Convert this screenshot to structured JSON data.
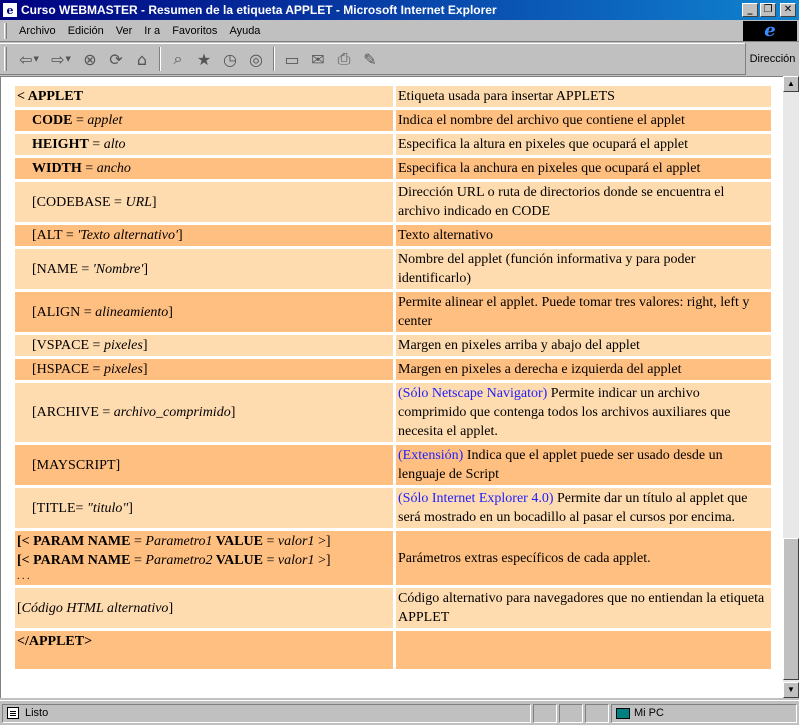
{
  "window": {
    "title": "Curso WEBMASTER - Resumen de la etiqueta APPLET - Microsoft Internet Explorer",
    "icon": "ie-document-icon"
  },
  "menu": {
    "items": [
      "Archivo",
      "Edición",
      "Ver",
      "Ir a",
      "Favoritos",
      "Ayuda"
    ]
  },
  "toolbar": {
    "icons": [
      "back-icon",
      "forward-icon",
      "stop-icon",
      "refresh-icon",
      "home-icon",
      "search-icon",
      "favorites-icon",
      "history-icon",
      "channels-icon",
      "fullscreen-icon",
      "mail-icon",
      "print-icon",
      "edit-icon"
    ],
    "address_label": "Dirección"
  },
  "colors": {
    "row_light": "#ffdcb0",
    "row_dark": "#ffbf80",
    "link_blue": "#2020ff"
  },
  "table": {
    "rows": [
      {
        "attr": "< APPLET",
        "desc": "Etiqueta usada para insertar APPLETS"
      },
      {
        "attr_name": "CODE",
        "attr_eq": "=",
        "attr_val": "applet",
        "desc": "Indica el nombre del archivo que contiene el applet"
      },
      {
        "attr_name": "HEIGHT",
        "attr_eq": "=",
        "attr_val": "alto",
        "desc": "Especifica la altura en pixeles que ocupará el applet"
      },
      {
        "attr_name": "WIDTH",
        "attr_eq": "=",
        "attr_val": "ancho",
        "desc": "Especifica la anchura en pixeles que ocupará el applet"
      },
      {
        "attr_pre": "[CODEBASE = ",
        "attr_val": "URL",
        "attr_post": "]",
        "desc": "Dirección URL o ruta de directorios donde se encuentra el archivo indicado en CODE"
      },
      {
        "attr_pre": "[ALT = ",
        "attr_val": "'Texto alternativo'",
        "attr_post": "]",
        "desc": "Texto alternativo"
      },
      {
        "attr_pre": "[NAME = ",
        "attr_val": "'Nombre'",
        "attr_post": "]",
        "desc": "Nombre del applet (función informativa y para poder identificarlo)"
      },
      {
        "attr_pre": "[ALIGN = ",
        "attr_val": "alineamiento",
        "attr_post": "]",
        "desc": "Permite alinear el applet. Puede tomar tres valores: right, left y center"
      },
      {
        "attr_pre": "[VSPACE = ",
        "attr_val": "pixeles",
        "attr_post": "]",
        "desc": "Margen en pixeles arriba y abajo del applet"
      },
      {
        "attr_pre": "[HSPACE = ",
        "attr_val": "pixeles",
        "attr_post": "]",
        "desc": "Margen en pixeles a derecha e izquierda del applet"
      },
      {
        "attr_pre": "[ARCHIVE = ",
        "attr_val": "archivo_comprimido",
        "attr_post": "]",
        "desc_note": "(Sólo Netscape Navigator)",
        "desc": " Permite indicar un archivo comprimido que contenga todos los archivos auxiliares que necesita el applet."
      },
      {
        "attr": "[MAYSCRIPT]",
        "desc_note": "(Extensión)",
        "desc": " Indica que el applet puede ser usado desde un lenguaje de Script"
      },
      {
        "attr_pre": "[TITLE= ",
        "attr_val": "\"titulo\"",
        "attr_post": "]",
        "desc_note": "(Sólo Internet Explorer 4.0)",
        "desc": " Permite dar un título al applet que será mostrado en un bocadillo al pasar el cursos por encima."
      },
      {
        "param1": {
          "open": "[< PARAM NAME",
          "eq1": " = ",
          "name": "Parametro1",
          "value_kw": " VALUE",
          "eq2": " = ",
          "value": "valor1",
          "close": " >]"
        },
        "param2": {
          "open": "[< PARAM NAME",
          "eq1": " = ",
          "name": "Parametro2",
          "value_kw": " VALUE",
          "eq2": " = ",
          "value": "valor1",
          "close": " >]"
        },
        "ellipsis": ". . .",
        "desc": "Parámetros extras específicos de cada applet."
      },
      {
        "attr_pre": "[",
        "attr_val": "Código HTML alternativo",
        "attr_post": "]",
        "desc": "Código alternativo para navegadores que no entiendan la etiqueta APPLET"
      },
      {
        "attr": "</APPLET>",
        "desc": ""
      }
    ]
  },
  "status": {
    "text": "Listo",
    "zone": "Mi PC"
  }
}
